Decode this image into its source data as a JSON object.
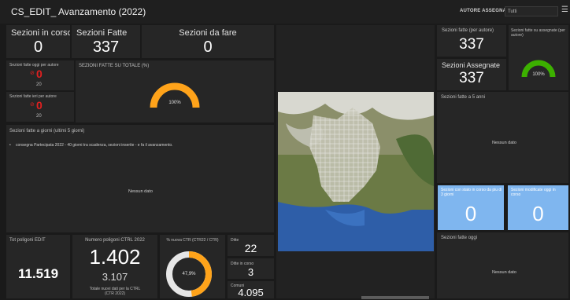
{
  "header": {
    "title": "CS_EDIT_ Avanzamento (2022)",
    "user_label": "AUTORE ASSEGNATO",
    "user_select_value": "Tutti",
    "menu_icon": "hamburger-icon"
  },
  "kpi": {
    "in_corso": {
      "label": "Sezioni in corso",
      "value": "0"
    },
    "fatte": {
      "label": "Sezioni Fatte",
      "value": "337"
    },
    "da_fare": {
      "label": "Sezioni da fare",
      "value": "0"
    }
  },
  "small_red": [
    {
      "title": "Sezioni fatte oggi per autore",
      "value": "0",
      "sub": "20",
      "icon": "alert-icon"
    },
    {
      "title": "Sezioni fatte ieri per autore",
      "value": "0",
      "sub": "20",
      "icon": "alert-icon"
    }
  ],
  "gauge_percent": {
    "title": "SEZIONI FATTE SU TOTALE (%)",
    "value": "100%",
    "fill": 1.0
  },
  "list_panel": {
    "title": "Sezioni fatte a giorni (ultimi 5 giorni)",
    "item": "consegna Partecipata 2022 - 40 giorni tra scadenza, sezioni inserite - e fa il avanzamento.",
    "nodata": "Nessun dato"
  },
  "right_top": {
    "fatte_autore": {
      "label": "Sezioni fatte (per autore)",
      "value": "337"
    },
    "assegnate": {
      "label": "Sezioni Assegnate",
      "value": "337"
    },
    "gauge_title": "Sezioni fatte su assegnate (per autore)",
    "gauge_value": "100%",
    "gauge_fill": 1.0
  },
  "right_mid": {
    "title": "Sezioni fatte a 5 anni",
    "nodata": "Nessun dato"
  },
  "blue_tiles": [
    {
      "title": "Sezioni con stato in corso da piu di 3 giorni",
      "value": "0"
    },
    {
      "title": "Sezioni modificate oggi in corso",
      "value": "0"
    }
  ],
  "right_bottom": {
    "title": "Sezioni fatte oggi",
    "nodata": "Nessun dato"
  },
  "bottom": {
    "poligoni": {
      "label": "Tot poligoni EDIT",
      "value": "11.519"
    },
    "numero": {
      "label": "Numero poligoni CTRL 2022",
      "value": "1.402",
      "sub_value": "3.107",
      "sub_label": "Totale nuovi dati per la CTRL (CTR 2022)"
    },
    "gauge": {
      "title": "% nuova CTR (CTR22 / CTR)",
      "value": "47,9%",
      "fill": 0.479
    },
    "stack": [
      {
        "label": "Ditte",
        "value": "22"
      },
      {
        "label": "Ditte in corso",
        "value": "3"
      },
      {
        "label": "Comuni",
        "value": "4.095"
      }
    ]
  },
  "colors": {
    "gauge_orange": "#ffa31a",
    "gauge_green": "#3cb000",
    "alert_red": "#e02020",
    "tile_blue": "#7fb6ef",
    "water": "#2e5ea8"
  }
}
